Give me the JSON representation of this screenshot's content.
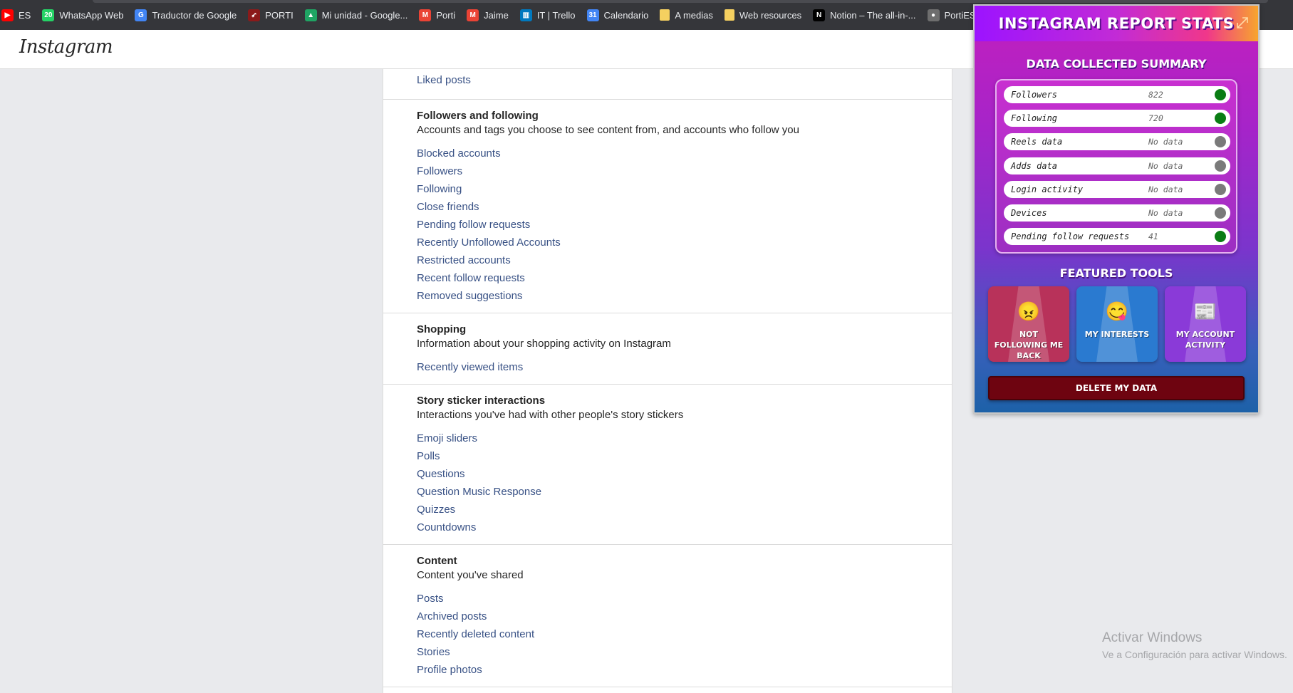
{
  "browser": {
    "bookmarks": [
      {
        "label": "ES",
        "icon": "youtube-icon",
        "color": "#ff0000",
        "glyph": "▶"
      },
      {
        "label": "WhatsApp Web",
        "icon": "whatsapp-icon",
        "color": "#25d366",
        "glyph": "20"
      },
      {
        "label": "Traductor de Google",
        "icon": "google-translate-icon",
        "color": "#4285f4",
        "glyph": "G"
      },
      {
        "label": "PORTI",
        "icon": "porti-icon",
        "color": "#8b1a1a",
        "glyph": "➹"
      },
      {
        "label": "Mi unidad - Google...",
        "icon": "google-drive-icon",
        "color": "#1fa463",
        "glyph": "▲"
      },
      {
        "label": "Porti",
        "icon": "gmail-icon",
        "color": "#ea4335",
        "glyph": "M"
      },
      {
        "label": "Jaime",
        "icon": "gmail-icon",
        "color": "#ea4335",
        "glyph": "M"
      },
      {
        "label": "IT | Trello",
        "icon": "trello-icon",
        "color": "#0079bf",
        "glyph": "▥"
      },
      {
        "label": "Calendario",
        "icon": "google-calendar-icon",
        "color": "#4285f4",
        "glyph": "31"
      },
      {
        "label": "A medias",
        "icon": "folder-icon",
        "color": "#f5d060",
        "glyph": ""
      },
      {
        "label": "Web resources",
        "icon": "folder-icon",
        "color": "#f5d060",
        "glyph": ""
      },
      {
        "label": "Notion – The all-in-...",
        "icon": "notion-icon",
        "color": "#ffffff",
        "glyph": "N"
      },
      {
        "label": "PortiESP (PRTI)",
        "icon": "github-icon",
        "color": "#6e6e6e",
        "glyph": "●"
      },
      {
        "label": "",
        "icon": "vercel-icon",
        "color": "#ffffff",
        "glyph": "▲"
      }
    ]
  },
  "header": {
    "logo": "Instagram"
  },
  "main": {
    "top_link": "Liked posts",
    "sections": [
      {
        "title": "Followers and following",
        "desc": "Accounts and tags you choose to see content from, and accounts who follow you",
        "links": [
          "Blocked accounts",
          "Followers",
          "Following",
          "Close friends",
          "Pending follow requests",
          "Recently Unfollowed Accounts",
          "Restricted accounts",
          "Recent follow requests",
          "Removed suggestions"
        ]
      },
      {
        "title": "Shopping",
        "desc": "Information about your shopping activity on Instagram",
        "links": [
          "Recently viewed items"
        ]
      },
      {
        "title": "Story sticker interactions",
        "desc": "Interactions you've had with other people's story stickers",
        "links": [
          "Emoji sliders",
          "Polls",
          "Questions",
          "Question Music Response",
          "Quizzes",
          "Countdowns"
        ]
      },
      {
        "title": "Content",
        "desc": "Content you've shared",
        "links": [
          "Posts",
          "Archived posts",
          "Recently deleted content",
          "Stories",
          "Profile photos"
        ]
      }
    ]
  },
  "watermark": {
    "line1": "Activar Windows",
    "line2": "Ve a Configuración para activar Windows."
  },
  "popup": {
    "title": "INSTAGRAM REPORT STATS",
    "summary_title": "DATA COLLECTED SUMMARY",
    "rows": [
      {
        "label": "Followers",
        "value": "822",
        "status_color": "#0a7d14"
      },
      {
        "label": "Following",
        "value": "720",
        "status_color": "#0a7d14"
      },
      {
        "label": "Reels data",
        "value": "No data",
        "status_color": "#7a7a7a"
      },
      {
        "label": "Adds data",
        "value": "No data",
        "status_color": "#7a7a7a"
      },
      {
        "label": "Login activity",
        "value": "No data",
        "status_color": "#7a7a7a"
      },
      {
        "label": "Devices",
        "value": "No data",
        "status_color": "#7a7a7a"
      },
      {
        "label": "Pending follow requests",
        "value": "41",
        "status_color": "#0a7d14"
      }
    ],
    "tools_title": "FEATURED TOOLS",
    "tools": [
      {
        "label": "NOT FOLLOWING ME BACK",
        "icon": "angry-face-icon",
        "glyph": "😠",
        "color": "#b8325a"
      },
      {
        "label": "MY INTERESTS",
        "icon": "yum-face-icon",
        "glyph": "😋",
        "color": "#2a7ad0"
      },
      {
        "label": "MY ACCOUNT ACTIVITY",
        "icon": "newspaper-icon",
        "glyph": "📰",
        "color": "#8a3ad8"
      }
    ],
    "delete_label": "DELETE MY DATA"
  }
}
